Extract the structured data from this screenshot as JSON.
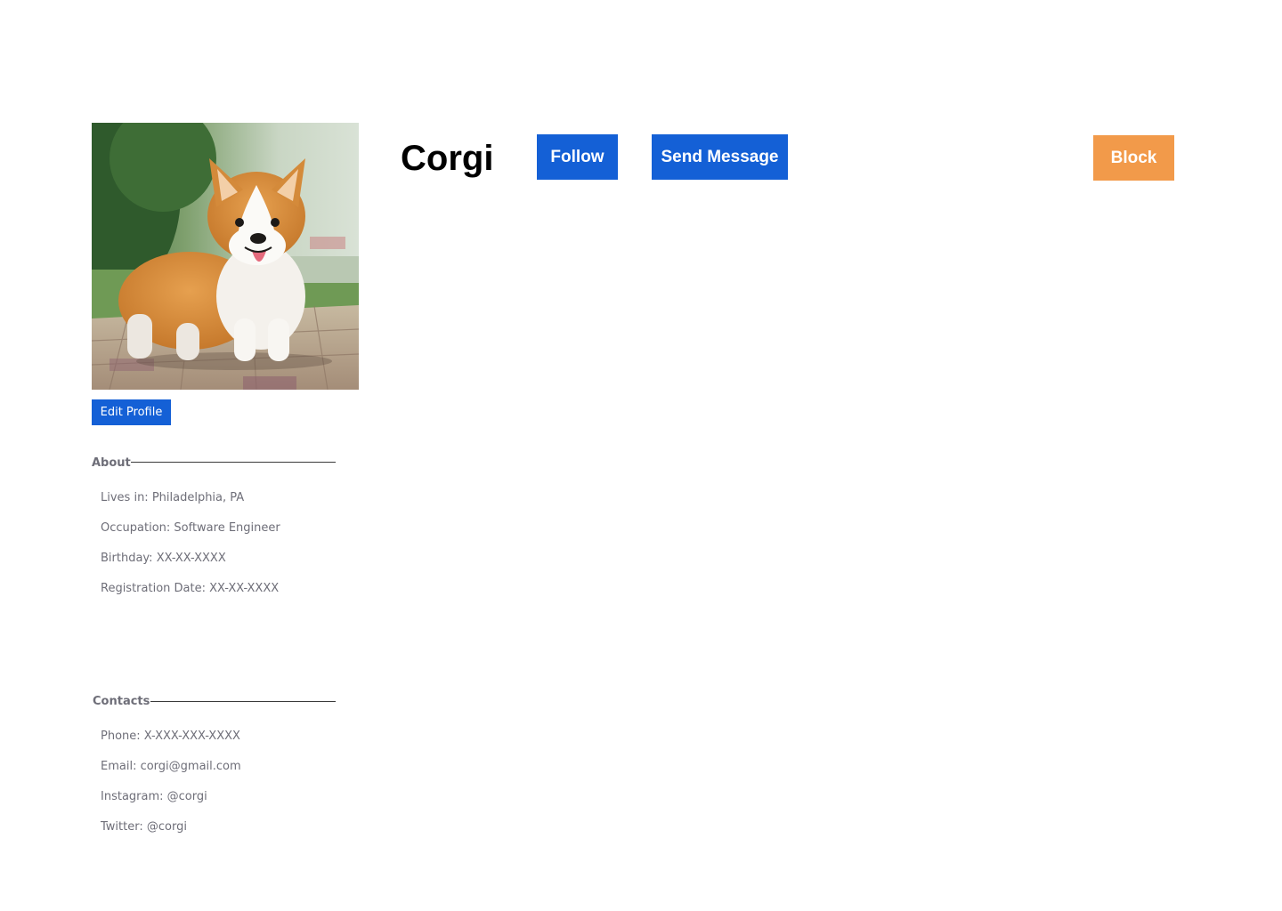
{
  "profile": {
    "name": "Corgi",
    "photo_subject": "corgi-photo"
  },
  "actions": {
    "edit_profile_label": "Edit Profile",
    "follow_label": "Follow",
    "send_message_label": "Send Message",
    "block_label": "Block"
  },
  "about": {
    "title": "About",
    "items": [
      "Lives in: Philadelphia, PA",
      "Occupation: Software Engineer",
      "Birthday: XX-XX-XXXX",
      "Registration Date: XX-XX-XXXX"
    ]
  },
  "contacts": {
    "title": "Contacts",
    "items": [
      "Phone: X-XXX-XXX-XXXX",
      "Email: corgi@gmail.com",
      "Instagram: @corgi",
      "Twitter: @corgi"
    ]
  },
  "colors": {
    "primary": "#1460d6",
    "warning": "#f29a4a",
    "muted_text": "#6e6e78",
    "heading_text": "#000000"
  }
}
